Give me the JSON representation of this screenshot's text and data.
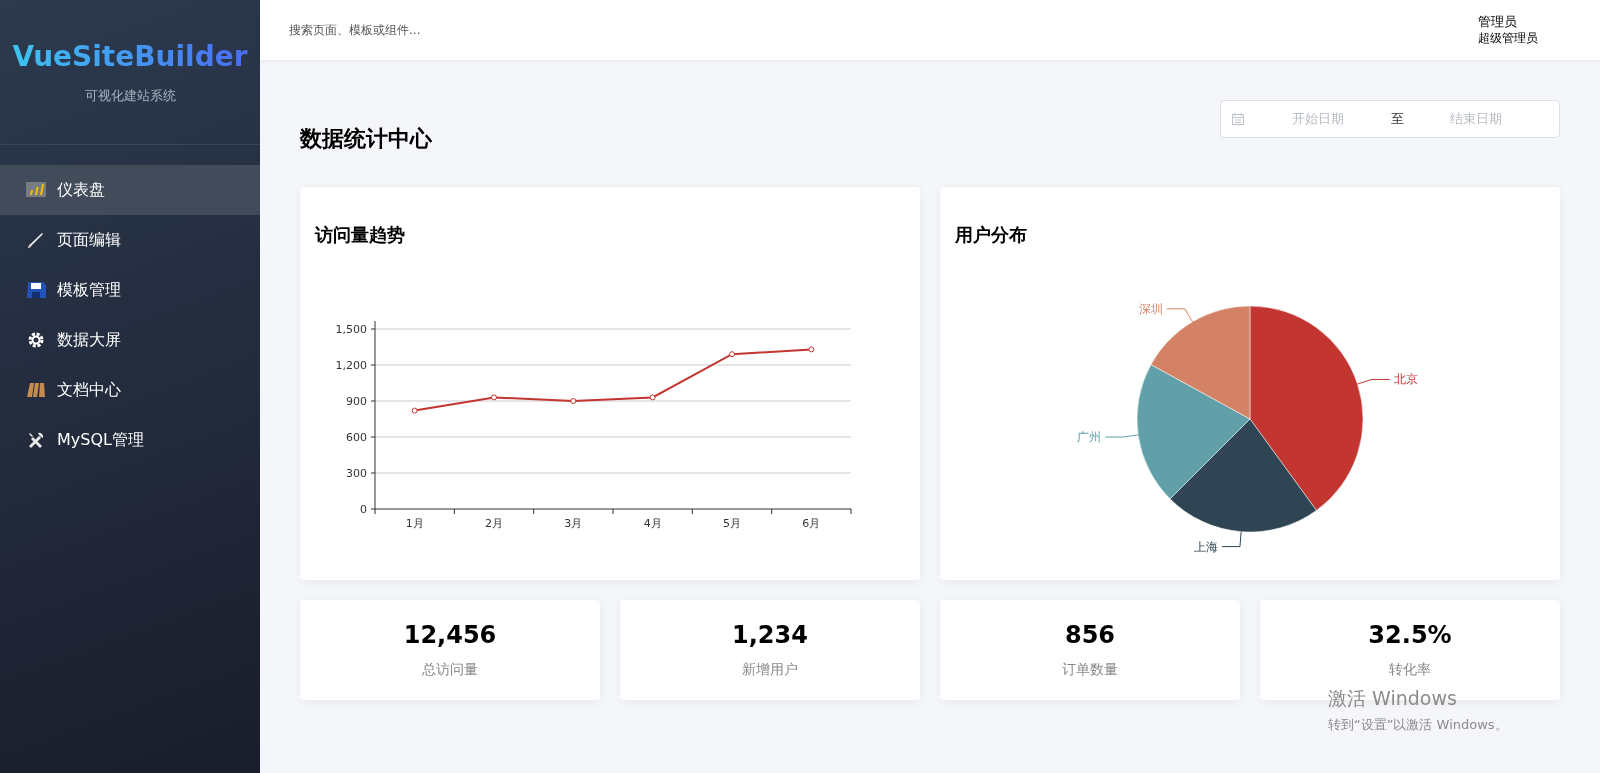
{
  "sidebar": {
    "logo": "VueSiteBuilder",
    "subtitle": "可视化建站系统",
    "items": [
      {
        "label": "仪表盘",
        "selected": true
      },
      {
        "label": "页面编辑",
        "selected": false
      },
      {
        "label": "模板管理",
        "selected": false
      },
      {
        "label": "数据大屏",
        "selected": false
      },
      {
        "label": "文档中心",
        "selected": false
      },
      {
        "label": "MySQL管理",
        "selected": false
      }
    ]
  },
  "header": {
    "search": {
      "placeholder": "搜索页面、模板或组件..."
    },
    "user": {
      "name": "管理员",
      "role": "超级管理员"
    }
  },
  "page_title": "数据统计中心",
  "date_range": {
    "start_placeholder": "开始日期",
    "separator": "至",
    "end_placeholder": "结束日期"
  },
  "visits_card": {
    "title": "访问量趋势",
    "chart_data": {
      "type": "line",
      "categories": [
        "1月",
        "2月",
        "3月",
        "4月",
        "5月",
        "6月"
      ],
      "ylim": [
        0,
        1500
      ],
      "yticks": [
        {
          "value": 0,
          "label": "0"
        },
        {
          "value": 300,
          "label": "300"
        },
        {
          "value": 600,
          "label": "600"
        },
        {
          "value": 900,
          "label": "900"
        },
        {
          "value": 1200,
          "label": "1,200"
        },
        {
          "value": 1500,
          "label": "1,500"
        }
      ],
      "grid": true,
      "series": [
        {
          "color": "#c23531",
          "marker": true,
          "values": [
            820,
            930,
            900,
            930,
            1290,
            1330
          ]
        }
      ]
    }
  },
  "users_card": {
    "title": "用户分布",
    "chart_data": {
      "type": "pie",
      "categories": [
        "北京",
        "上海",
        "广州",
        "深圳"
      ],
      "values": [
        40,
        22.5,
        20.5,
        17
      ],
      "colors": [
        "#c23531",
        "#2f4554",
        "#61a0a8",
        "#d48265"
      ]
    }
  },
  "stats": [
    {
      "value": "12,456",
      "label": "总访问量"
    },
    {
      "value": "1,234",
      "label": "新增用户"
    },
    {
      "value": "856",
      "label": "订单数量"
    },
    {
      "value": "32.5%",
      "label": "转化率"
    }
  ],
  "activation_notice": {
    "title": "激活 Windows",
    "subtitle": "转到“设置”以激活 Windows。"
  }
}
